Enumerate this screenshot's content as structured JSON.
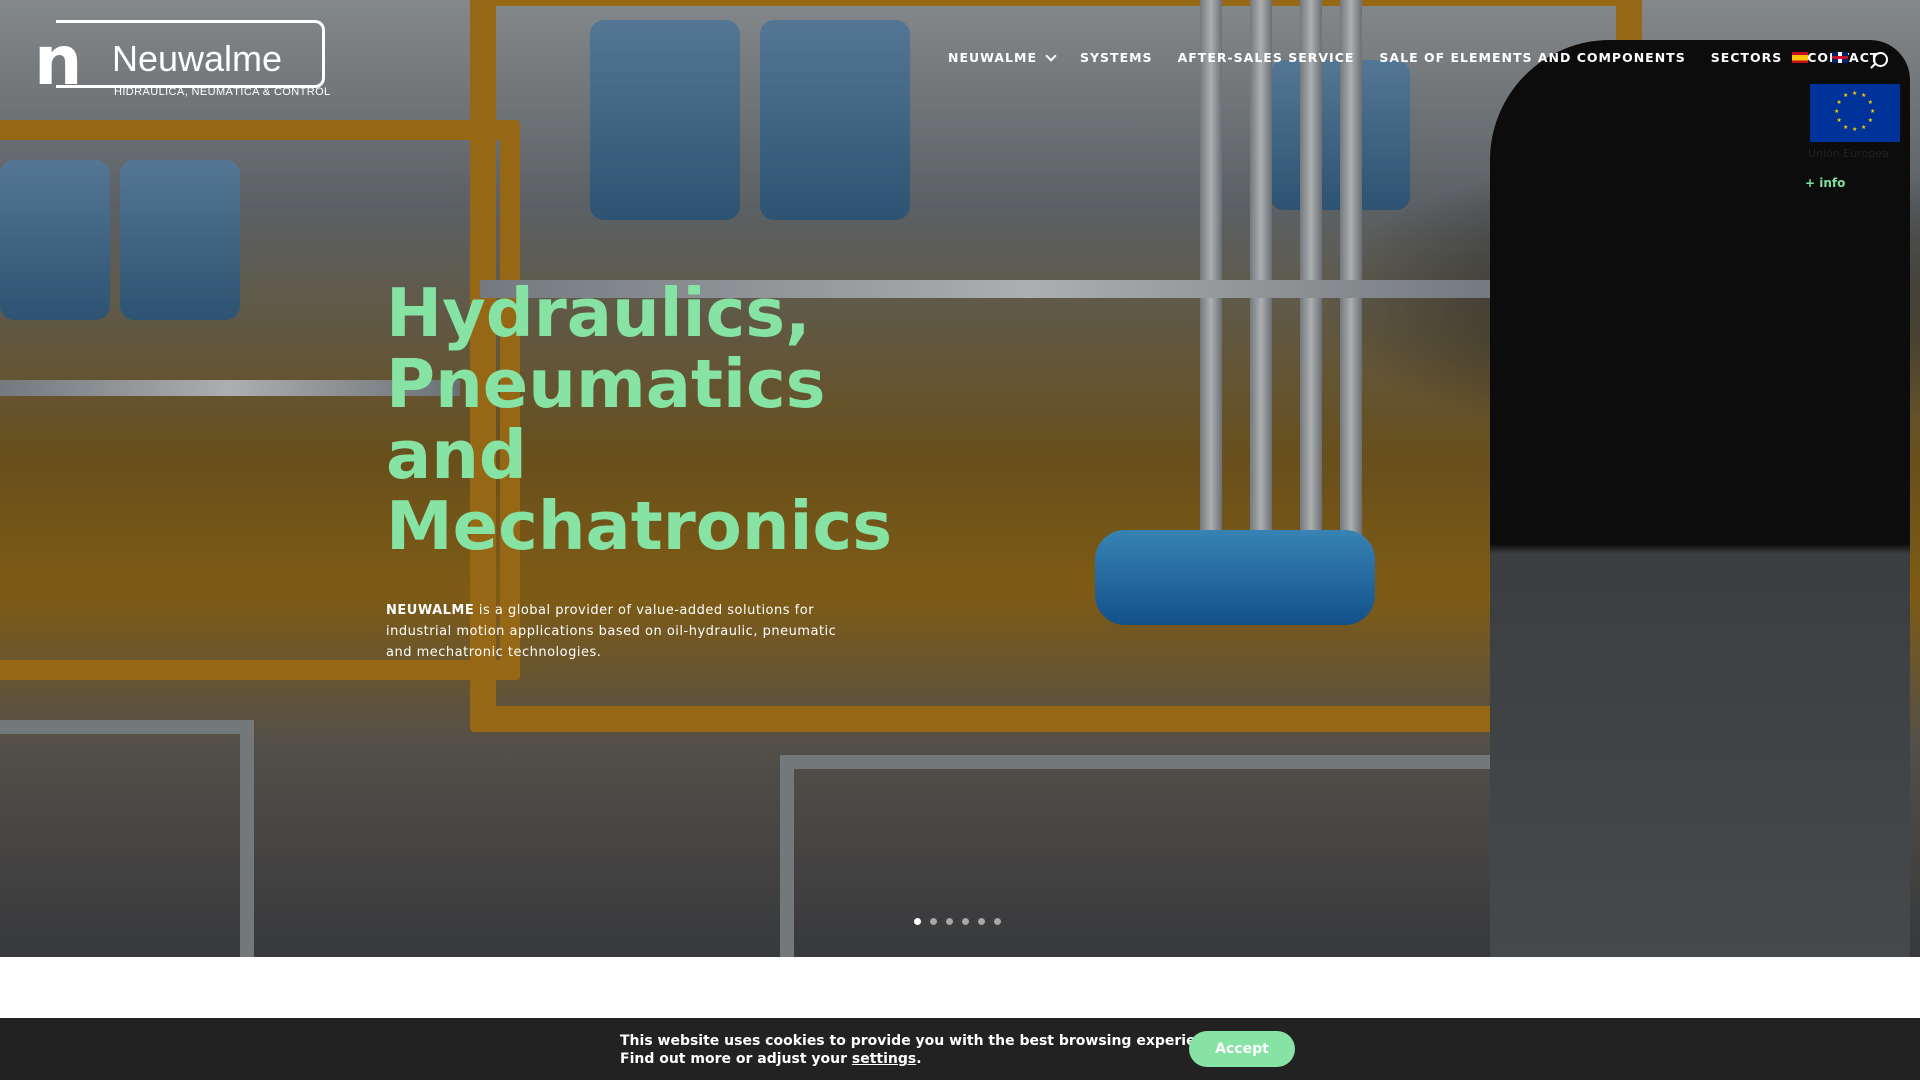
{
  "brand": {
    "name": "Neuwalme",
    "tagline": "HIDRÁULICA, NEUMÁTICA & CONTROL",
    "mark": "n"
  },
  "nav": {
    "items": [
      {
        "label": "NEUWALME",
        "has_dropdown": true
      },
      {
        "label": "SYSTEMS"
      },
      {
        "label": "AFTER-SALES SERVICE"
      },
      {
        "label": "SALE OF ELEMENTS AND COMPONENTS"
      },
      {
        "label": "SECTORS"
      },
      {
        "label": "CONTACT"
      }
    ],
    "languages": [
      "es-flag-icon",
      "en-flag-icon"
    ],
    "search_icon": "search-icon"
  },
  "eu_badge": {
    "label": "Unión Europea",
    "info_link": "+ info"
  },
  "hero": {
    "headline_lines": [
      "Hydraulics,",
      "Pneumatics",
      "and",
      "Mechatronics"
    ],
    "description_brand": "NEUWALME",
    "description_rest": " is a global provider of value-added solutions for industrial motion applications based on oil-hydraulic, pneumatic and mechatronic technologies.",
    "slides_total": 6,
    "slide_active": 1
  },
  "cookie": {
    "line1": "This website uses cookies to provide you with the best browsing experience.",
    "line2_prefix": "Find out more or adjust your ",
    "settings_link": "settings",
    "line2_suffix": ".",
    "accept_label": "Accept"
  },
  "colors": {
    "accent": "#86e3a4",
    "cookie_bg": "#222222",
    "eu_blue": "#003399",
    "eu_gold": "#ffcc00"
  }
}
